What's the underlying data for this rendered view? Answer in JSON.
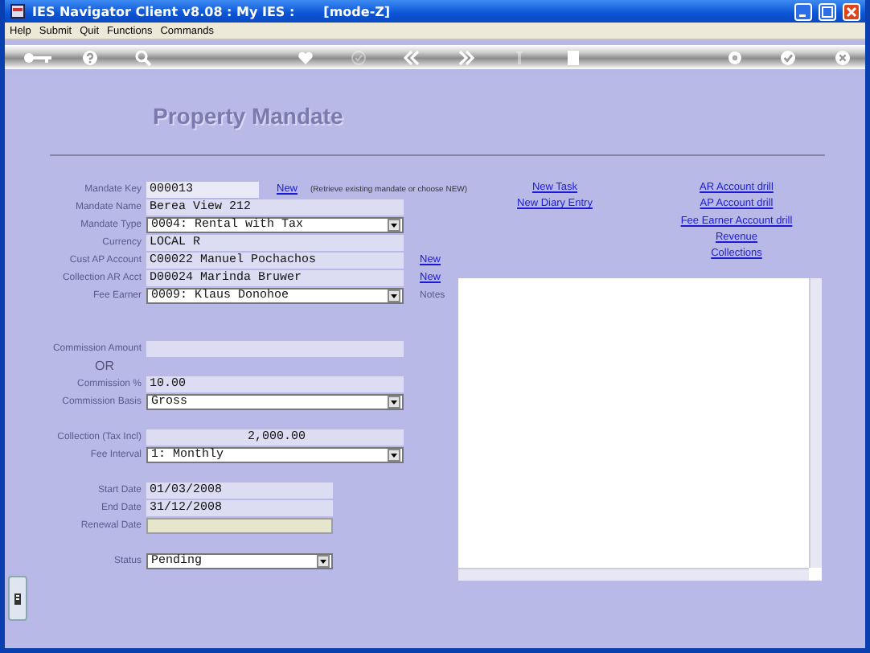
{
  "window": {
    "title": "IES Navigator Client v8.08 : My IES :",
    "mode": "[mode-Z]"
  },
  "menu": [
    "Help",
    "Submit",
    "Quit",
    "Functions",
    "Commands"
  ],
  "toolbar": [
    {
      "disabled": false
    },
    {
      "disabled": false
    },
    {
      "disabled": false
    },
    {
      "disabled": false
    },
    {
      "disabled": true
    },
    {
      "disabled": false
    },
    {
      "disabled": false
    },
    {
      "disabled": true
    },
    {
      "disabled": false
    },
    {
      "disabled": false
    },
    {
      "disabled": false
    },
    {
      "disabled": false
    }
  ],
  "heading": "Property Mandate",
  "sections": [
    [
      {
        "label": "Mandate Key",
        "kind": "input",
        "value": "000013",
        "link": "New",
        "hint": "(Retrieve existing mandate or choose NEW)"
      },
      {
        "label": "Mandate Name",
        "kind": "readonly",
        "value": "Berea View 212"
      },
      {
        "label": "Mandate Type",
        "kind": "select",
        "value": "0004: Rental with Tax"
      },
      {
        "label": "Currency",
        "kind": "readonly",
        "value": "LOCAL R"
      },
      {
        "label": "Cust AP Account",
        "kind": "readonly",
        "value": "C00022 Manuel Pochachos",
        "link": "New"
      },
      {
        "label": "Collection AR Acct",
        "kind": "readonly",
        "value": "D00024 Marinda Bruwer",
        "link": "New"
      },
      {
        "label": "Fee Earner",
        "kind": "select",
        "value": "0009: Klaus Donohoe"
      }
    ],
    [
      {
        "label": "Commission Amount",
        "kind": "readonly"
      },
      {
        "label": "OR",
        "kind": "note"
      },
      {
        "label": "Commission %",
        "kind": "readonly",
        "value": "10.00"
      },
      {
        "label": "Commission Basis",
        "kind": "select",
        "value": "Gross"
      }
    ],
    [
      {
        "label": "Collection (Tax Incl)",
        "kind": "amount",
        "value": "2,000.00"
      },
      {
        "label": "Fee Interval",
        "kind": "select",
        "value": "1: Monthly"
      }
    ],
    [
      {
        "label": "Start Date",
        "kind": "readonly",
        "value": "01/03/2008"
      },
      {
        "label": "End Date",
        "kind": "readonly",
        "value": "31/12/2008"
      },
      {
        "label": "Renewal Date",
        "kind": "empty"
      }
    ],
    [
      {
        "label": "Status",
        "kind": "select",
        "value": "Pending"
      }
    ]
  ],
  "task_links": [
    "New Task",
    "New Diary Entry"
  ],
  "drill_links": [
    "AR Account drill",
    "AP Account drill",
    "Fee Earner Account drill",
    "Revenue",
    "Collections"
  ],
  "notes": {
    "label": "Notes"
  }
}
